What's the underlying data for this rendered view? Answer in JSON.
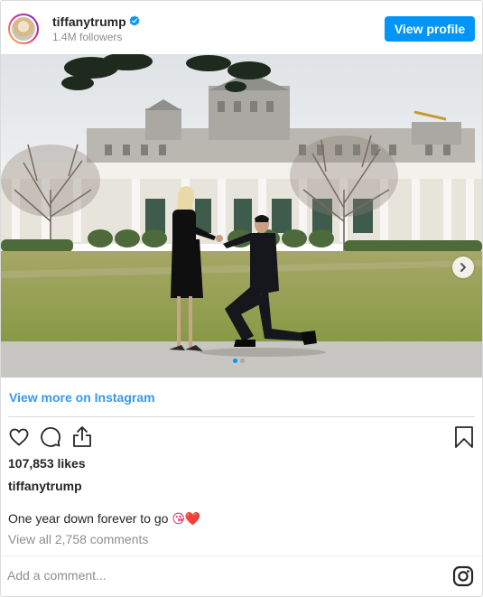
{
  "header": {
    "username": "tiffanytrump",
    "followers": "1.4M followers",
    "view_profile_label": "View profile"
  },
  "photo": {
    "carousel_dots": 2,
    "active_dot": 1
  },
  "footer": {
    "view_more_label": "View more on Instagram",
    "likes": "107,853 likes",
    "owner": "tiffanytrump",
    "caption_text": "One year down forever to go ",
    "caption_emoji": "😘❤️",
    "comments_link": "View all 2,758 comments",
    "comment_placeholder": "Add a comment..."
  },
  "icons": [
    "heart-icon",
    "comment-icon",
    "share-icon",
    "bookmark-icon",
    "instagram-logo-icon",
    "verified-badge-icon",
    "chevron-right-icon"
  ],
  "colors": {
    "accent": "#0095f6",
    "link": "#3897f0",
    "text": "#262626",
    "muted": "#8e8e8e",
    "heart_emoji": "#e0245e"
  }
}
